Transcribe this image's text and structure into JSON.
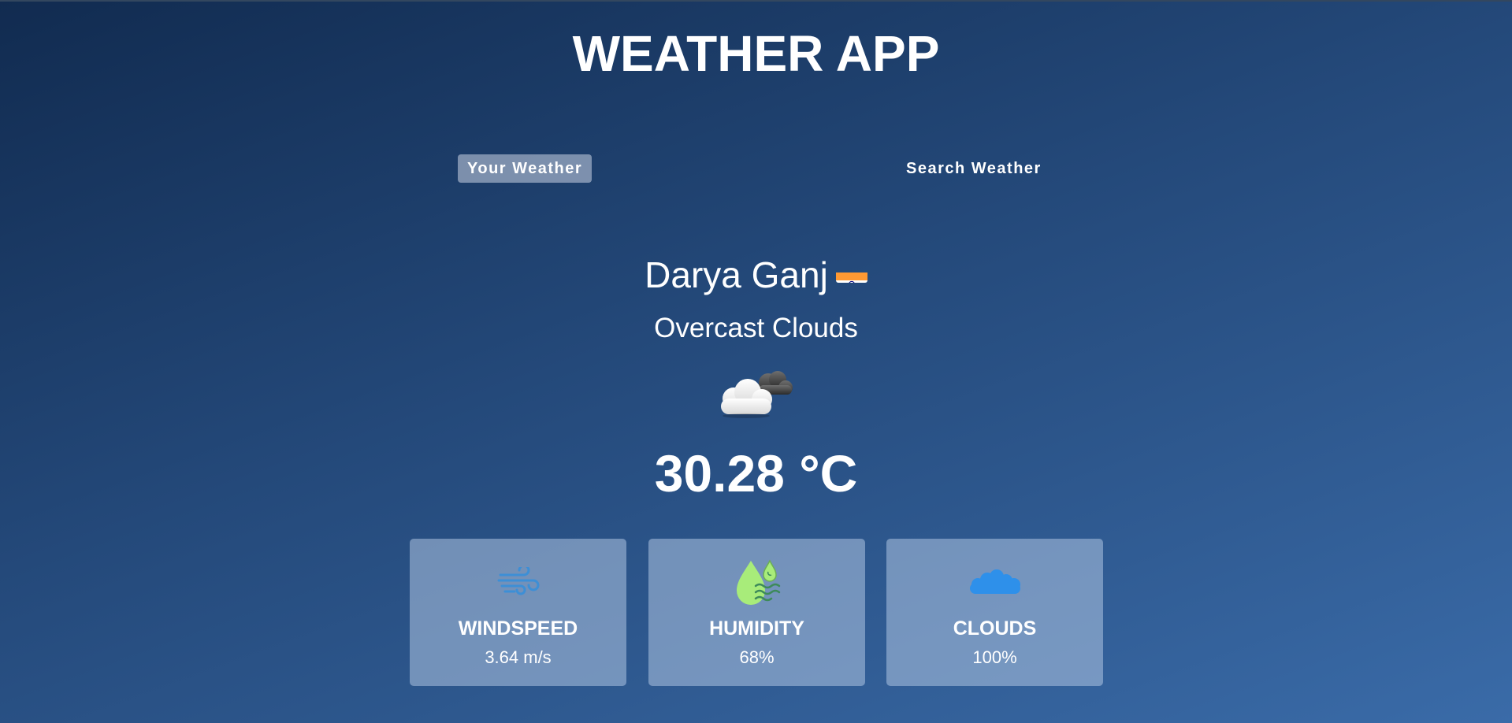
{
  "app": {
    "title": "WEATHER APP"
  },
  "tabs": [
    {
      "label": "Your Weather",
      "active": true
    },
    {
      "label": "Search Weather",
      "active": false
    }
  ],
  "weather": {
    "city": "Darya Ganj",
    "country_flag": "india-flag",
    "description": "Overcast Clouds",
    "condition_icon": "overcast-clouds-icon",
    "temperature": "30.28 °C"
  },
  "metrics": [
    {
      "label": "WINDSPEED",
      "value": "3.64 m/s",
      "icon": "wind-icon"
    },
    {
      "label": "HUMIDITY",
      "value": "68%",
      "icon": "humidity-icon"
    },
    {
      "label": "CLOUDS",
      "value": "100%",
      "icon": "clouds-icon"
    }
  ],
  "colors": {
    "background_start": "#112b50",
    "background_end": "#3a6ba8",
    "card_background": "#afc4e1",
    "active_tab": "#dbe2ef",
    "wind_icon": "#3d8fd6",
    "humidity_icon": "#a8ec7a",
    "clouds_icon": "#2e90ea"
  }
}
